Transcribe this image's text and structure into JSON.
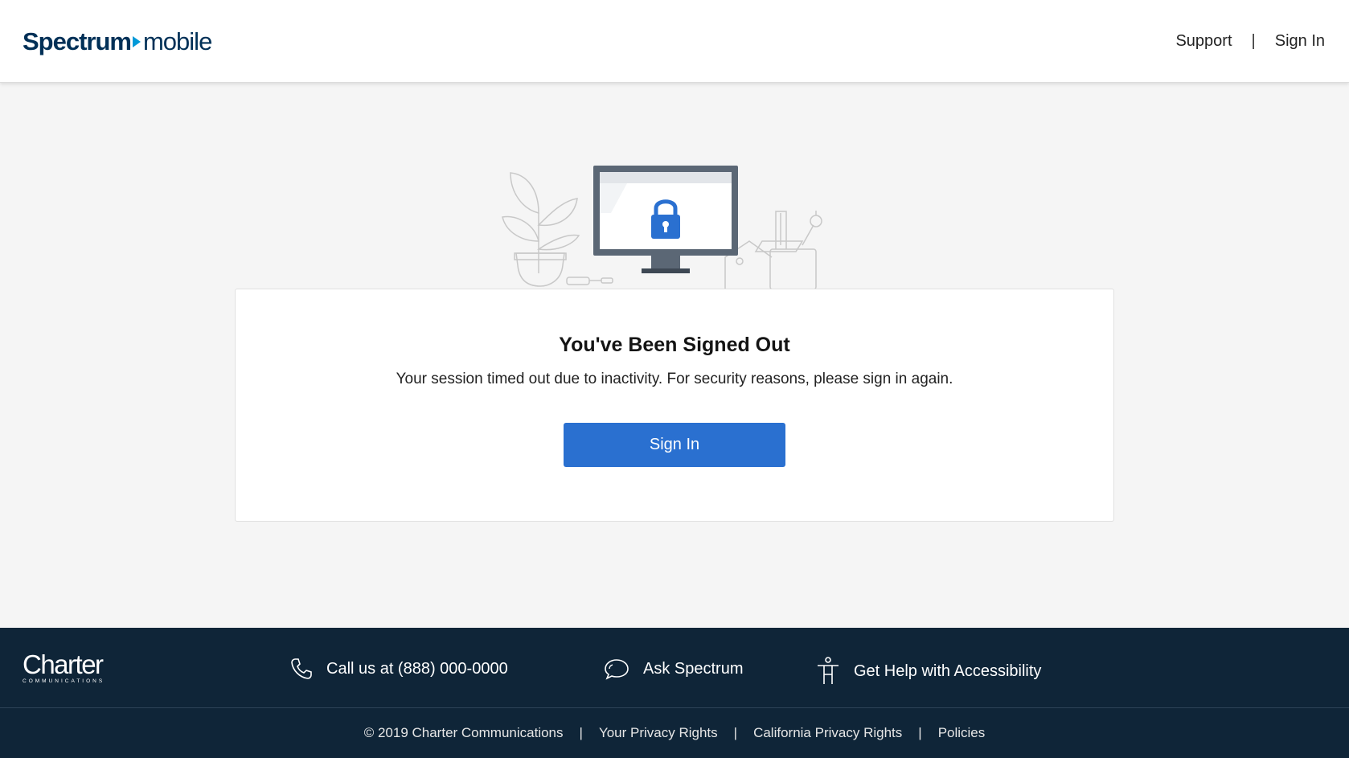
{
  "header": {
    "logo_brand": "Spectrum",
    "logo_sub": "mobile",
    "nav": {
      "support": "Support",
      "separator": "|",
      "sign_in": "Sign In"
    }
  },
  "card": {
    "title": "You've Been Signed Out",
    "message": "Your session timed out due to inactivity. For security reasons, please sign in again.",
    "button_label": "Sign In"
  },
  "footer": {
    "logo_name": "Charter",
    "logo_tagline": "COMMUNICATIONS",
    "call": "Call us at (888) 000-0000",
    "ask": "Ask Spectrum",
    "accessibility": "Get Help with Accessibility",
    "copyright": "© 2019 Charter Communications",
    "separator": "|",
    "privacy": "Your Privacy Rights",
    "california": "California Privacy Rights",
    "policies": "Policies"
  },
  "colors": {
    "brand_navy": "#003057",
    "brand_arrow": "#0099d8",
    "button_blue": "#2a70d0",
    "footer_bg": "#0f2538",
    "page_bg": "#f5f5f5"
  },
  "icons": [
    "lock-icon",
    "phone-icon",
    "chat-icon",
    "accessibility-icon"
  ]
}
